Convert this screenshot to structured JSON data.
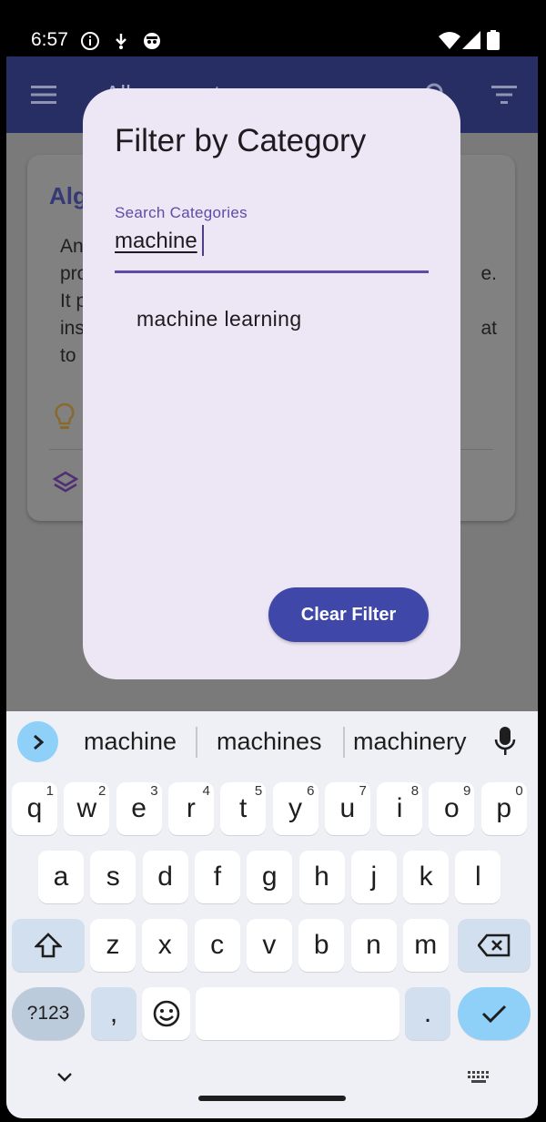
{
  "status_bar": {
    "time": "6:57"
  },
  "app": {
    "title": "All concepts",
    "card": {
      "title": "Alg",
      "lines": [
        "An",
        "pro",
        "It p",
        "ins",
        "to"
      ],
      "line_suffixes": [
        "",
        "e.",
        "",
        "at",
        ""
      ]
    }
  },
  "dialog": {
    "title": "Filter by Category",
    "field_label": "Search Categories",
    "field_value": "machine",
    "options": [
      "machine learning"
    ],
    "clear_button": "Clear Filter"
  },
  "keyboard": {
    "suggestions": [
      "machine",
      "machines",
      "machinery"
    ],
    "row1": [
      {
        "k": "q",
        "h": "1"
      },
      {
        "k": "w",
        "h": "2"
      },
      {
        "k": "e",
        "h": "3"
      },
      {
        "k": "r",
        "h": "4"
      },
      {
        "k": "t",
        "h": "5"
      },
      {
        "k": "y",
        "h": "6"
      },
      {
        "k": "u",
        "h": "7"
      },
      {
        "k": "i",
        "h": "8"
      },
      {
        "k": "o",
        "h": "9"
      },
      {
        "k": "p",
        "h": "0"
      }
    ],
    "row2": [
      "a",
      "s",
      "d",
      "f",
      "g",
      "h",
      "j",
      "k",
      "l"
    ],
    "row3": [
      "z",
      "x",
      "c",
      "v",
      "b",
      "n",
      "m"
    ],
    "sym_label": "?123",
    "comma": ",",
    "period": "."
  },
  "colors": {
    "accent": "#5e4ca7",
    "button": "#3f48a8",
    "dialog_bg": "#ede6f4",
    "keyboard_bg": "#eef0f5"
  }
}
